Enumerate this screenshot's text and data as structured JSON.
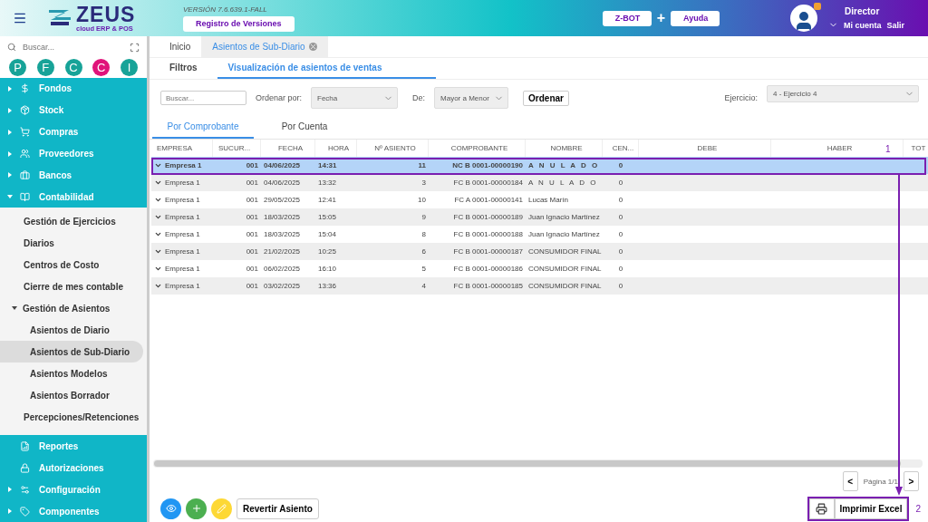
{
  "header": {
    "logo": {
      "name": "ZEUS",
      "tagline": "cloud ERP & POS"
    },
    "version": "VERSIÓN 7.6.639.1-FALL",
    "versions_button": "Registro de Versiones",
    "zbot_button": "Z-BOT",
    "plus": "+",
    "help_button": "Ayuda",
    "user": {
      "name": "Director",
      "account_link": "Mi cuenta",
      "logout_link": "Salir"
    }
  },
  "sidebar": {
    "search": {
      "placeholder": "Buscar..."
    },
    "shortcuts": [
      {
        "label": "P",
        "color": "#17a398"
      },
      {
        "label": "F",
        "color": "#17a398"
      },
      {
        "label": "C",
        "color": "#17a398"
      },
      {
        "label": "C",
        "color": "#e0147a"
      },
      {
        "label": "I",
        "color": "#17a398"
      }
    ],
    "items": [
      {
        "label": "Fondos",
        "expanded": false
      },
      {
        "label": "Stock",
        "expanded": false
      },
      {
        "label": "Compras",
        "expanded": false
      },
      {
        "label": "Proveedores",
        "expanded": false
      },
      {
        "label": "Bancos",
        "expanded": false
      },
      {
        "label": "Contabilidad",
        "expanded": true,
        "children": [
          {
            "label": "Gestión de Ejercicios",
            "selected": false
          },
          {
            "label": "Diarios",
            "selected": false
          },
          {
            "label": "Centros de Costo",
            "selected": false
          },
          {
            "label": "Cierre de mes contable",
            "selected": false
          },
          {
            "label": "Gestión de Asientos",
            "selected": false,
            "expanded": true,
            "children": [
              {
                "label": "Asientos de Diario",
                "selected": false
              },
              {
                "label": "Asientos de Sub-Diario",
                "selected": true
              },
              {
                "label": "Asientos Modelos",
                "selected": false
              },
              {
                "label": "Asientos Borrador",
                "selected": false
              }
            ]
          },
          {
            "label": "Percepciones/Retenciones",
            "selected": false
          }
        ]
      },
      {
        "label": "Reportes"
      },
      {
        "label": "Autorizaciones"
      },
      {
        "label": "Configuración",
        "expanded": false
      },
      {
        "label": "Componentes",
        "expanded": false
      }
    ]
  },
  "tabs": [
    {
      "label": "Inicio",
      "selected": false
    },
    {
      "label": "Asientos de Sub-Diario",
      "selected": true,
      "closable": true
    }
  ],
  "subtabs": [
    {
      "label": "Filtros",
      "selected": false
    },
    {
      "label": "Visualización de asientos de ventas",
      "selected": true
    }
  ],
  "filters": {
    "search": {
      "placeholder": "Buscar..."
    },
    "order_by_label": "Ordenar por:",
    "order_by": "Fecha",
    "direction_label": "De:",
    "direction": "Mayor a Menor",
    "order_button": "Ordenar",
    "exercise_label": "Ejercicio:",
    "exercise": "4 - Ejercicio 4"
  },
  "view_tabs": [
    {
      "label": "Por Comprobante",
      "selected": true
    },
    {
      "label": "Por Cuenta",
      "selected": false
    }
  ],
  "table": {
    "columns": [
      "EMPRESA",
      "SUCUR...",
      "FECHA",
      "HORA",
      "Nº ASIENTO",
      "COMPROBANTE",
      "NOMBRE",
      "CEN...",
      "DEBE",
      "HABER",
      "TOT"
    ],
    "rows": [
      {
        "selected": true,
        "cells": [
          "Empresa 1",
          "001",
          "04/06/2025",
          "14:31",
          "11",
          "NC B 0001-00000190",
          "A N U L A D O",
          "0"
        ]
      },
      {
        "selected": false,
        "cells": [
          "Empresa 1",
          "001",
          "04/06/2025",
          "13:32",
          "3",
          "FC B 0001-00000184",
          "A N U L A D O",
          "0"
        ]
      },
      {
        "selected": false,
        "cells": [
          "Empresa 1",
          "001",
          "29/05/2025",
          "12:41",
          "10",
          "FC A 0001-00000141",
          "Lucas Marín",
          "0"
        ]
      },
      {
        "selected": false,
        "cells": [
          "Empresa 1",
          "001",
          "18/03/2025",
          "15:05",
          "9",
          "FC B 0001-00000189",
          "Juan Ignacio Martínez",
          "0"
        ]
      },
      {
        "selected": false,
        "cells": [
          "Empresa 1",
          "001",
          "18/03/2025",
          "15:04",
          "8",
          "FC B 0001-00000188",
          "Juan Ignacio Martínez",
          "0"
        ]
      },
      {
        "selected": false,
        "cells": [
          "Empresa 1",
          "001",
          "21/02/2025",
          "10:25",
          "6",
          "FC B 0001-00000187",
          "CONSUMIDOR FINAL",
          "0"
        ]
      },
      {
        "selected": false,
        "cells": [
          "Empresa 1",
          "001",
          "06/02/2025",
          "16:10",
          "5",
          "FC B 0001-00000186",
          "CONSUMIDOR FINAL",
          "0"
        ]
      },
      {
        "selected": false,
        "cells": [
          "Empresa 1",
          "001",
          "03/02/2025",
          "13:36",
          "4",
          "FC B 0001-00000185",
          "CONSUMIDOR FINAL",
          "0"
        ]
      }
    ]
  },
  "pager": {
    "prev": "<",
    "label": "Página 1/1",
    "next": ">"
  },
  "actions": {
    "revert_button": "Revertir Asiento",
    "excel_button": "Imprimir Excel"
  },
  "annotations": [
    {
      "label": "1"
    },
    {
      "label": "2"
    }
  ]
}
